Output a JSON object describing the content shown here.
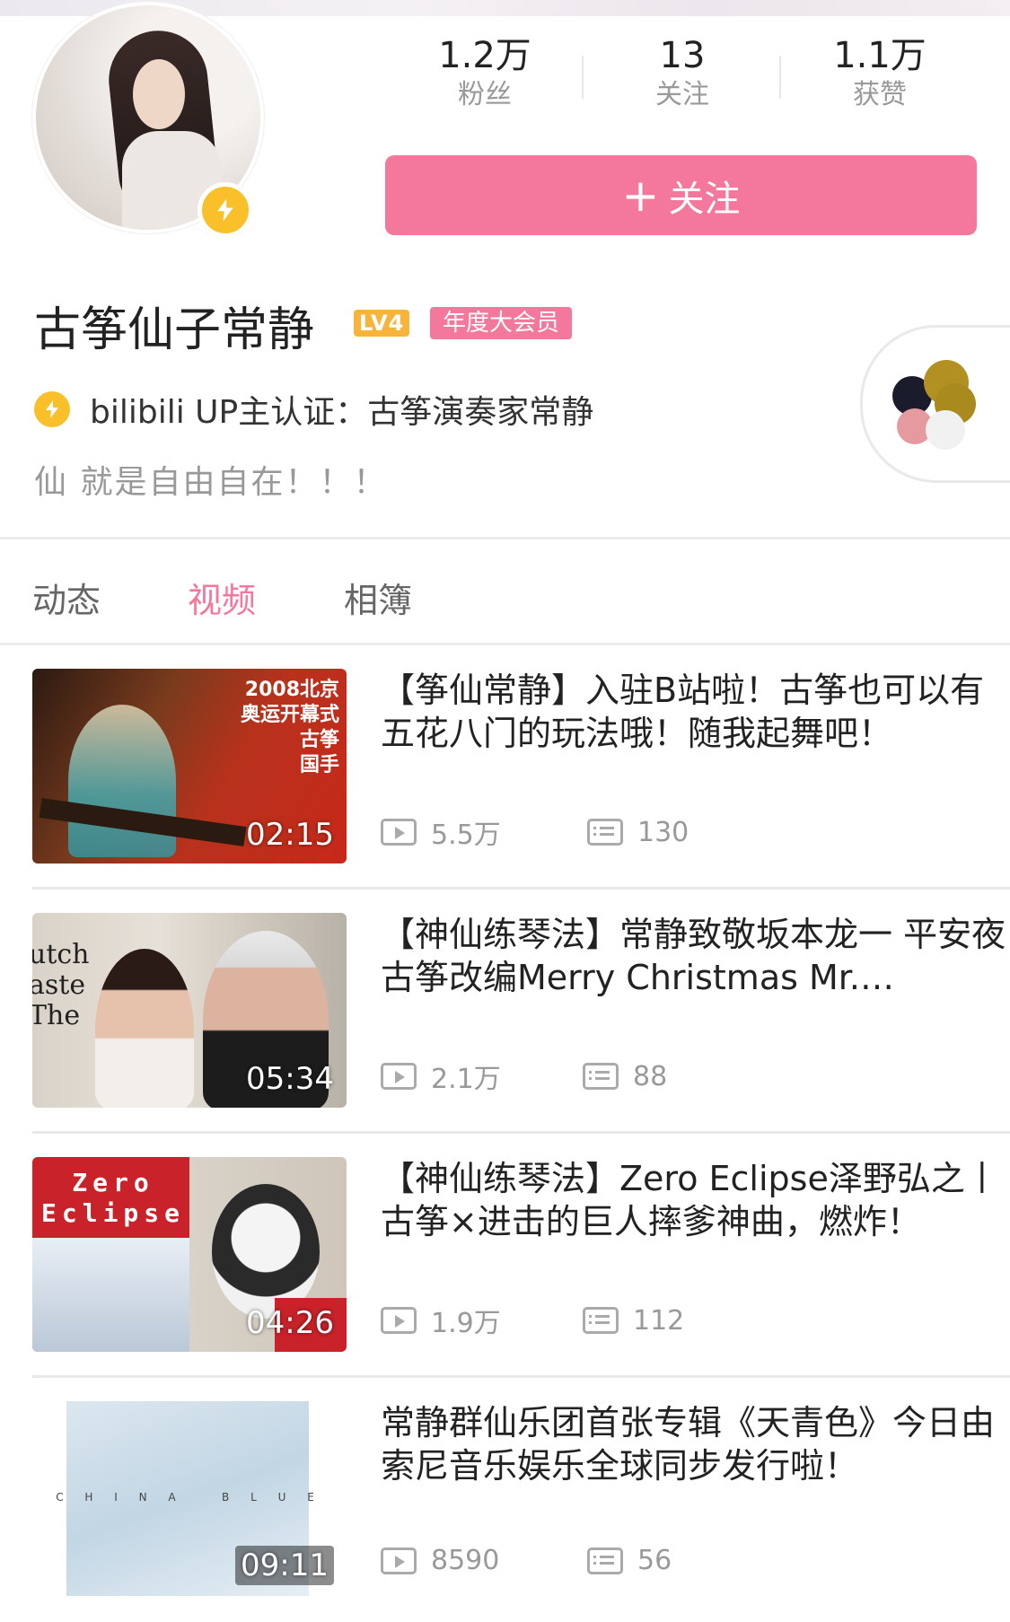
{
  "profile": {
    "stats": [
      {
        "value": "1.2万",
        "label": "粉丝"
      },
      {
        "value": "13",
        "label": "关注"
      },
      {
        "value": "1.1万",
        "label": "获赞"
      }
    ],
    "follow_label": "关注",
    "follow_plus": "+",
    "username": "古筝仙子常静",
    "level": "LV4",
    "vip": "年度大会员",
    "certification": "bilibili UP主认证：古筝演奏家常静",
    "bio": "仙 就是自由自在！！！"
  },
  "tabs": [
    "动态",
    "视频",
    "相簿"
  ],
  "active_tab": 1,
  "videos": [
    {
      "title": "【筝仙常静】入驻B站啦！古筝也可以有五花八门的玩法哦！随我起舞吧！",
      "duration": "02:15",
      "views": "5.5万",
      "comments": "130",
      "thumb_text": "2008北京\n奥运开幕式\n古筝\n国手"
    },
    {
      "title": "【神仙练琴法】常静致敬坂本龙一 平安夜古筝改编Merry Christmas Mr. Lawrence",
      "duration": "05:34",
      "views": "2.1万",
      "comments": "88",
      "thumb_text": "utch\naste\nThe"
    },
    {
      "title": "【神仙练琴法】Zero Eclipse泽野弘之丨古筝×进击的巨人摔爹神曲，燃炸！",
      "duration": "04:26",
      "views": "1.9万",
      "comments": "112",
      "thumb_text": "Zero\nEclipse"
    },
    {
      "title": "常静群仙乐团首张专辑《天青色》今日由索尼音乐娱乐全球同步发行啦！",
      "duration": "09:11",
      "views": "8590",
      "comments": "56",
      "thumb_text": "C H I N A   B L U E"
    }
  ],
  "colors": {
    "accent": "#f4779c",
    "badge_yellow": "#f9c02a",
    "level_orange": "#f7b33a"
  }
}
